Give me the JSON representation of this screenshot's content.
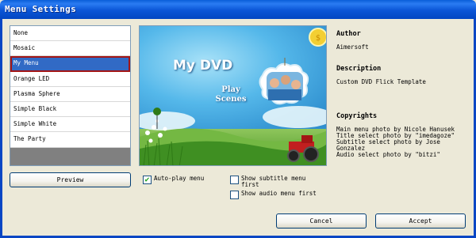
{
  "window": {
    "title": "Menu Settings"
  },
  "menu_list": {
    "items": [
      {
        "label": "None",
        "selected": false
      },
      {
        "label": "Mosaic",
        "selected": false
      },
      {
        "label": "My Menu",
        "selected": true
      },
      {
        "label": "Orange LED",
        "selected": false
      },
      {
        "label": "Plasma Sphere",
        "selected": false
      },
      {
        "label": "Simple Black",
        "selected": false
      },
      {
        "label": "Simple White",
        "selected": false
      },
      {
        "label": "The Party",
        "selected": false
      }
    ]
  },
  "preview": {
    "dvd_title": "My DVD",
    "play_label": "Play",
    "scenes_label": "Scenes"
  },
  "info": {
    "author_heading": "Author",
    "author_value": "Aimersoft",
    "description_heading": "Description",
    "description_value": "Custom DVD Flick Template",
    "copyrights_heading": "Copyrights",
    "copyrights_lines": [
      "Main menu photo by Nicole Hanusek",
      "Title select photo by \"imedagoze\"",
      "Subtitle select photo by Jose",
      "Gonzalez",
      "Audio select photo by \"bitzi\""
    ]
  },
  "buttons": {
    "preview": "Preview",
    "cancel": "Cancel",
    "accept": "Accept"
  },
  "options": {
    "autoplay": {
      "label": "Auto-play menu",
      "checked": true
    },
    "subtitle_first": {
      "label_line1": "Show subtitle menu",
      "label_line2": "first",
      "checked": false
    },
    "audio_first": {
      "label": "Show audio menu first",
      "checked": false
    }
  },
  "colors": {
    "titlebar": "#0a5ed8",
    "selection": "#316ac5",
    "selection_outline": "#a31515",
    "checkmark": "#21a121"
  }
}
